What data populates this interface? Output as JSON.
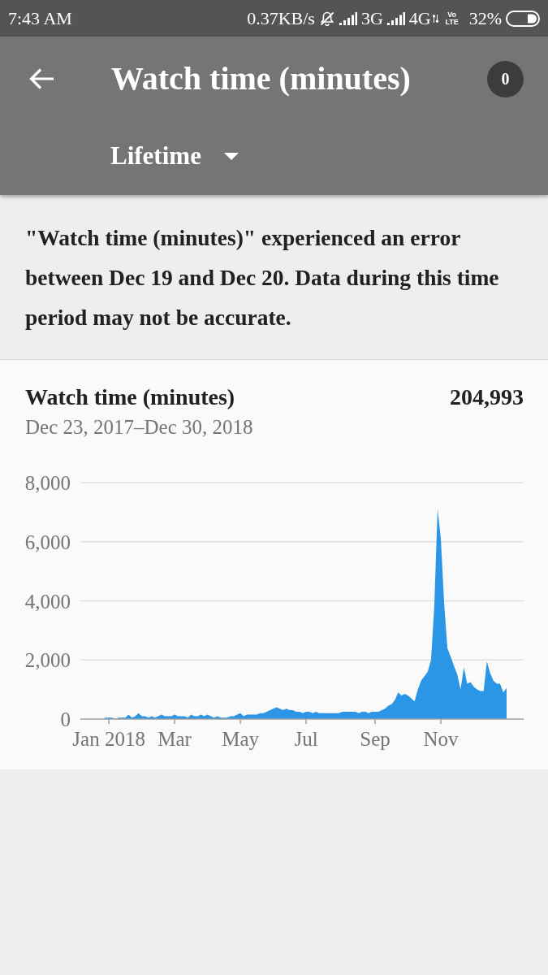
{
  "status_bar": {
    "time": "7:43 AM",
    "net_speed": "0.37KB/s",
    "sim1_network": "3G",
    "sim2_network": "4G",
    "volte_label": "Vo LTE",
    "battery": "32%"
  },
  "toolbar": {
    "title": "Watch time (minutes)",
    "notification_count": "0",
    "period": "Lifetime"
  },
  "error_notice": {
    "text": "\"Watch time (minutes)\" experienced an error between Dec 19 and Dec 20. Data during this time period may not be accurate."
  },
  "metric_card": {
    "title": "Watch time (minutes)",
    "total": "204,993",
    "date_range": "Dec 23, 2017–Dec 30, 2018",
    "chart_data": {
      "type": "area",
      "grid": true,
      "categories": [
        null,
        null,
        null,
        "Jan 2018",
        null,
        null,
        null,
        null,
        null,
        null,
        null,
        null,
        null,
        null,
        null,
        null,
        null,
        null,
        null,
        null,
        null,
        null,
        null,
        "Mar",
        null,
        null,
        null,
        null,
        null,
        null,
        null,
        null,
        null,
        null,
        null,
        null,
        null,
        null,
        null,
        null,
        null,
        null,
        null,
        "May",
        null,
        null,
        null,
        null,
        null,
        null,
        null,
        null,
        null,
        null,
        null,
        null,
        null,
        null,
        null,
        null,
        null,
        null,
        null,
        "Jul",
        null,
        null,
        null,
        null,
        null,
        null,
        null,
        null,
        null,
        null,
        null,
        null,
        null,
        null,
        null,
        null,
        null,
        null,
        null,
        null,
        "Sep",
        null,
        null,
        null,
        null,
        null,
        null,
        null,
        null,
        null,
        null,
        null,
        null,
        null,
        null,
        null,
        null,
        null,
        null,
        null,
        "Nov",
        null,
        null,
        null,
        null,
        null,
        null,
        null,
        null,
        null,
        null,
        null,
        null,
        null,
        null,
        null,
        null,
        null,
        null,
        null,
        null
      ],
      "series": [
        {
          "color": "#2b96e6",
          "values": [
            0,
            0,
            50,
            50,
            50,
            0,
            50,
            50,
            50,
            150,
            50,
            100,
            200,
            100,
            100,
            50,
            100,
            50,
            100,
            150,
            100,
            100,
            100,
            150,
            100,
            100,
            100,
            50,
            150,
            100,
            100,
            150,
            100,
            150,
            100,
            50,
            100,
            50,
            50,
            50,
            100,
            100,
            150,
            200,
            100,
            150,
            150,
            150,
            150,
            200,
            200,
            250,
            300,
            350,
            400,
            350,
            300,
            350,
            300,
            300,
            250,
            250,
            200,
            250,
            250,
            200,
            250,
            200,
            200,
            200,
            200,
            200,
            200,
            200,
            250,
            250,
            250,
            250,
            250,
            200,
            250,
            250,
            200,
            250,
            250,
            250,
            300,
            350,
            450,
            500,
            650,
            900,
            800,
            850,
            800,
            700,
            600,
            1000,
            1300,
            1450,
            1600,
            2000,
            3800,
            7100,
            6100,
            3900,
            2400,
            2100,
            1800,
            1500,
            1000,
            1750,
            1200,
            1250,
            1100,
            1000,
            950,
            950,
            1950,
            1550,
            1300,
            1200,
            1200,
            900,
            1050
          ]
        }
      ],
      "ylim": [
        0,
        8000
      ],
      "yticks": [
        {
          "value": 0,
          "label": "0"
        },
        {
          "value": 2000,
          "label": "2,000"
        },
        {
          "value": 4000,
          "label": "4,000"
        },
        {
          "value": 6000,
          "label": "6,000"
        },
        {
          "value": 8000,
          "label": "8,000"
        }
      ]
    }
  }
}
